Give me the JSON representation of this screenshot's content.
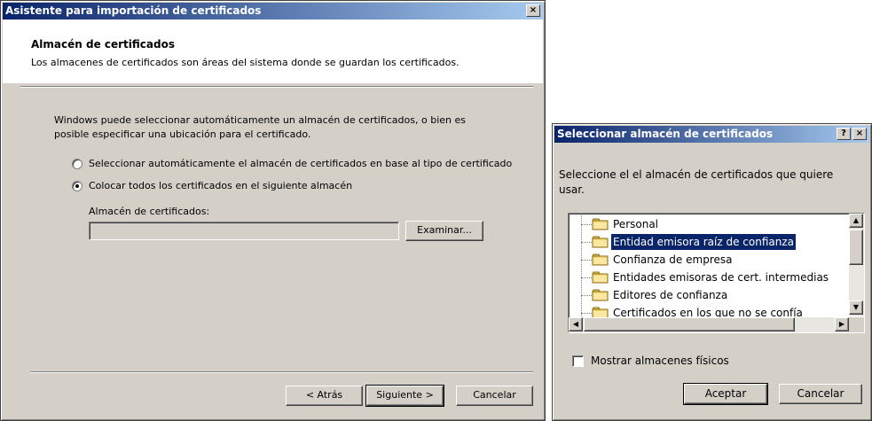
{
  "wizard": {
    "title": "Asistente para importación de certificados",
    "close_glyph": "×",
    "header_title": "Almacén de certificados",
    "header_desc": "Los almacenes de certificados son áreas del sistema donde se guardan los certificados.",
    "intro_line1": "Windows puede seleccionar automáticamente un almacén de certificados, o bien es",
    "intro_line2": "posible especificar una ubicación para el certificado.",
    "radio_auto_label": "Seleccionar automáticamente el almacén de certificados en base al tipo de certificado",
    "radio_manual_label": "Colocar todos los certificados en el siguiente almacén",
    "radio_selected": "manual",
    "store_label": "Almacén de certificados:",
    "store_value": "",
    "browse_button": "Examinar...",
    "back_button": "< Atrás",
    "next_button": "Siguiente >",
    "cancel_button": "Cancelar"
  },
  "select_dialog": {
    "title": "Seleccionar almacén de certificados",
    "help_glyph": "?",
    "close_glyph": "×",
    "prompt_line1": "Seleccione el el almacén de certificados que quiere",
    "prompt_line2": "usar.",
    "stores": [
      {
        "label": "Personal",
        "selected": false
      },
      {
        "label": "Entidad emisora raíz de confianza",
        "selected": true
      },
      {
        "label": "Confianza de empresa",
        "selected": false
      },
      {
        "label": "Entidades emisoras de cert. intermedias",
        "selected": false
      },
      {
        "label": "Editores de confianza",
        "selected": false
      },
      {
        "label": "Certificados en los que no se confía",
        "selected": false
      }
    ],
    "show_physical_label": "Mostrar almacenes físicos",
    "show_physical_checked": false,
    "ok_button": "Aceptar",
    "cancel_button": "Cancelar"
  },
  "colors": {
    "titlebar_start": "#0a246a",
    "titlebar_end": "#a6caf0",
    "face": "#d4d0c8",
    "selection": "#0a246a"
  }
}
